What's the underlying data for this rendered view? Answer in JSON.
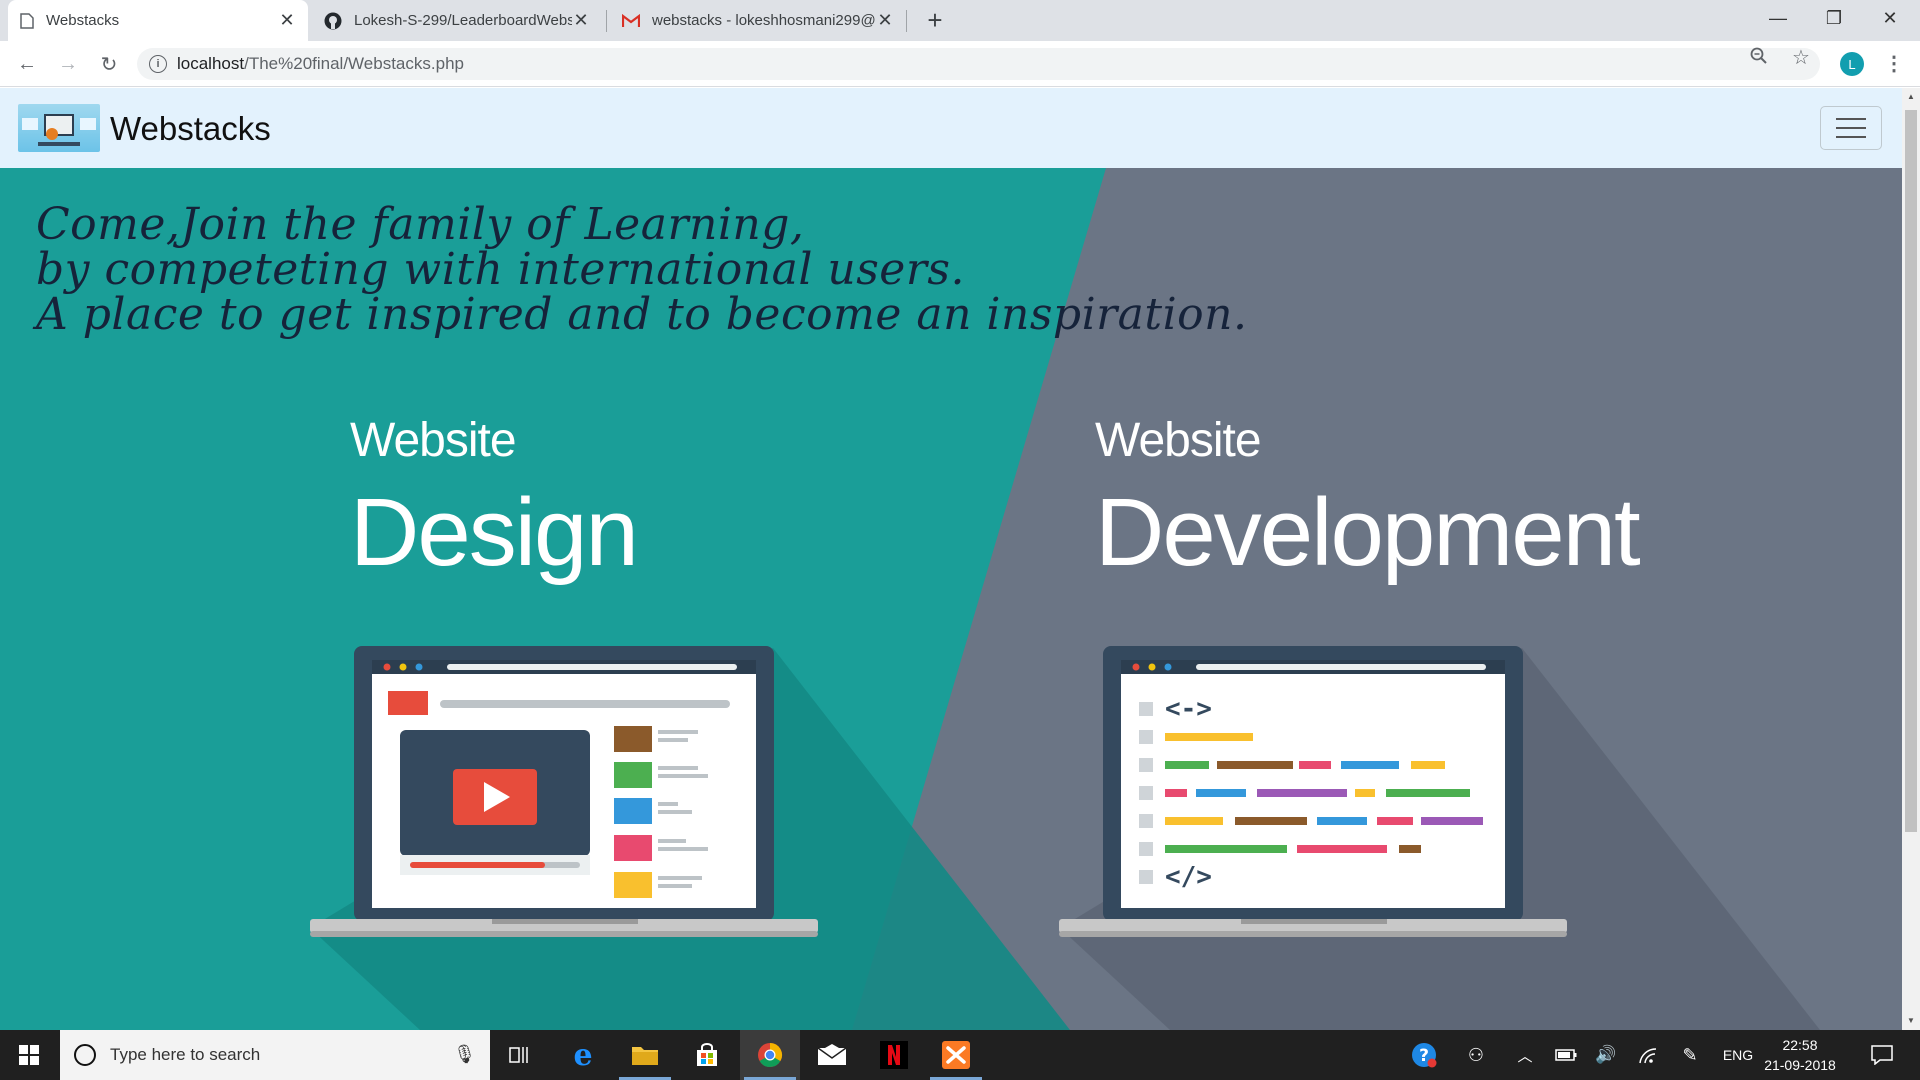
{
  "browser": {
    "tabs": [
      {
        "title": "Webstacks",
        "icon": "page-icon",
        "active": true
      },
      {
        "title": "Lokesh-S-299/LeaderboardWebs",
        "icon": "github-icon",
        "active": false
      },
      {
        "title": "webstacks - lokeshhosmani299@",
        "icon": "gmail-icon",
        "active": false
      }
    ],
    "address": {
      "host": "localhost",
      "path": "/The%20final/Webstacks.php"
    },
    "profile_initial": "L"
  },
  "site": {
    "brand": "Webstacks",
    "slogan": [
      "Come,Join the family of Learning,",
      "by competeting with international users.",
      "A place to get inspired and to become an inspiration."
    ],
    "left_panel": {
      "small": "Website",
      "big": "Design"
    },
    "right_panel": {
      "small": "Website",
      "big": "Development"
    },
    "code_open_tag": "<->",
    "code_close_tag": "</>"
  },
  "colors": {
    "teal": "#1a9e98",
    "slate": "#6b7585",
    "navbar": "#e3f2fd"
  },
  "taskbar": {
    "search_placeholder": "Type here to search",
    "language": "ENG",
    "time": "22:58",
    "date": "21-09-2018",
    "pinned": [
      "task-view-icon",
      "edge-icon",
      "file-explorer-icon",
      "store-icon",
      "chrome-icon",
      "mail-icon",
      "netflix-icon",
      "xampp-icon"
    ]
  }
}
